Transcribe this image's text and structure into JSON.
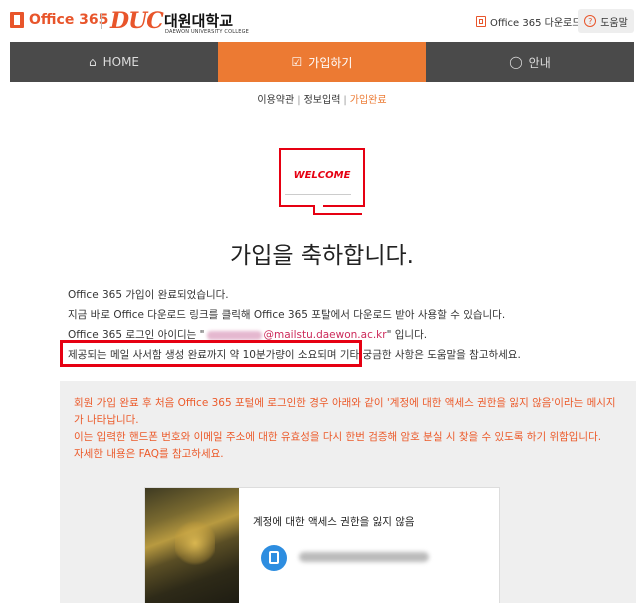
{
  "header": {
    "office_logo": "Office 365",
    "college_logo_mark": "DUC",
    "college_name_kor": "대원대학교",
    "college_name_eng": "DAEWON UNIVERSITY COLLEGE",
    "download_label": "Office 365 다운로드",
    "help_label": "도움말"
  },
  "nav": {
    "home_label": "HOME",
    "signup_label": "가입하기",
    "guide_label": "안내"
  },
  "breadcrumb": {
    "step1": "이용약관",
    "step2": "정보입력",
    "step3": "가입완료"
  },
  "welcome": {
    "sign_text": "WELCOME",
    "title": "가입을 축하합니다."
  },
  "message": {
    "line1": "Office 365 가입이 완료되었습니다.",
    "line2": "지금 바로 Office 다운로드 링크를 클릭해 Office 365 포탈에서 다운로드 받아 사용할 수 있습니다.",
    "line3_prefix": "Office 365 로그인 아이디는 \"",
    "line3_domain": "@mailstu.daewon.ac.kr",
    "line3_suffix": "\" 입니다.",
    "line4": "제공되는 메일 사서함 생성 완료까지 약 10분가량이 소요되며 기타 궁금한 사항은 도움말을 참고하세요."
  },
  "info": {
    "para1": "회원 가입 완료 후 처음 Office 365 포털에 로그인한 경우 아래와 같이 '계정에 대한 액세스 권한을 잃지 않음'이라는 메시지가 나타납니다.",
    "para2": "이는 입력한 핸드폰 번호와 이메일 주소에 대한 유효성을 다시 한번 검증해 암호 분실 시 찾을 수 있도록 하기 위함입니다.",
    "para3": "자세한 내용은 FAQ를 참고하세요.",
    "card_title": "계정에 대한 액세스 권한을 잃지 않음"
  },
  "colors": {
    "accent": "#ec7a33",
    "nav_bg": "#4a4a4a",
    "highlight_red": "#e60012"
  }
}
